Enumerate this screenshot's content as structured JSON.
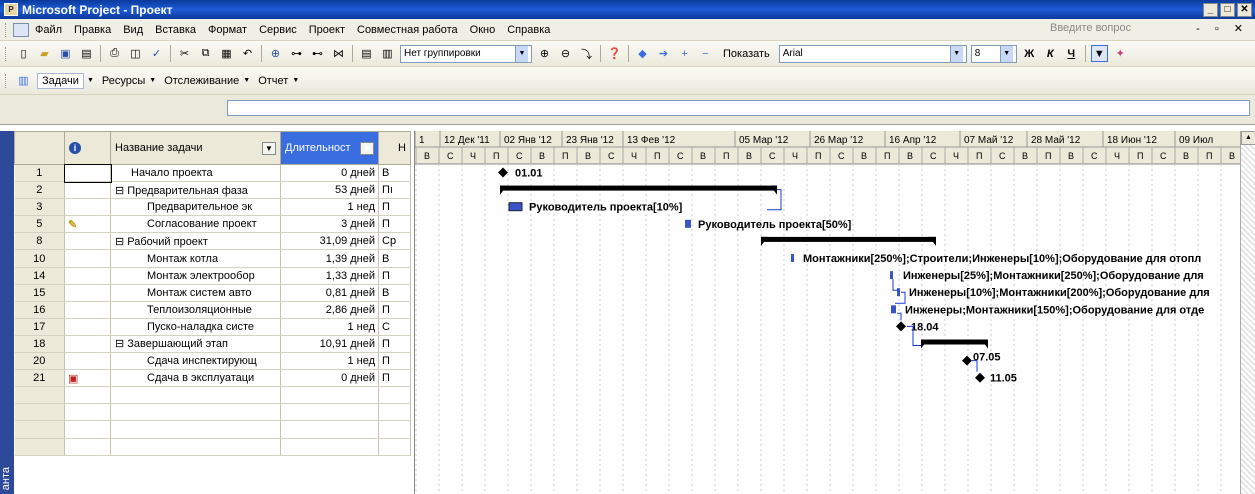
{
  "window": {
    "title": "Microsoft Project - Проект"
  },
  "menu": {
    "items": [
      "Файл",
      "Правка",
      "Вид",
      "Вставка",
      "Формат",
      "Сервис",
      "Проект",
      "Совместная работа",
      "Окно",
      "Справка"
    ],
    "ask_placeholder": "Введите вопрос"
  },
  "toolbar": {
    "grouping": "Нет группировки",
    "show": "Показать",
    "font": "Arial",
    "font_size": "8",
    "bold": "Ж",
    "italic": "К",
    "underline": "Ч"
  },
  "guide": {
    "tasks": "Задачи",
    "resources": "Ресурсы",
    "tracking": "Отслеживание",
    "report": "Отчет"
  },
  "view_label": "анта",
  "table": {
    "headers": {
      "info": "i",
      "name": "Название задачи",
      "duration": "Длительност",
      "start": "Н"
    },
    "rows": [
      {
        "id": "1",
        "name": "Начало проекта",
        "duration": "0 дней",
        "start": "В",
        "summary": false,
        "indent": 1
      },
      {
        "id": "2",
        "name": "⊟ Предварительная фаза",
        "duration": "53 дней",
        "start": "Пı",
        "summary": true,
        "indent": 0
      },
      {
        "id": "3",
        "name": "Предварительное эк",
        "duration": "1 нед",
        "start": "П",
        "summary": false,
        "indent": 2
      },
      {
        "id": "5",
        "name": "Согласование проект",
        "duration": "3 дней",
        "start": "П",
        "summary": false,
        "indent": 2
      },
      {
        "id": "8",
        "name": "⊟ Рабочий проект",
        "duration": "31,09 дней",
        "start": "Ср",
        "summary": true,
        "indent": 0
      },
      {
        "id": "10",
        "name": "Монтаж котла",
        "duration": "1,39 дней",
        "start": "В",
        "summary": false,
        "indent": 2
      },
      {
        "id": "14",
        "name": "Монтаж электрообор",
        "duration": "1,33 дней",
        "start": "П",
        "summary": false,
        "indent": 2
      },
      {
        "id": "15",
        "name": "Монтаж систем авто",
        "duration": "0,81 дней",
        "start": "В",
        "summary": false,
        "indent": 2
      },
      {
        "id": "16",
        "name": "Теплоизоляционные",
        "duration": "2,86 дней",
        "start": "П",
        "summary": false,
        "indent": 2
      },
      {
        "id": "17",
        "name": "Пуско-наладка систе",
        "duration": "1 нед",
        "start": "С",
        "summary": false,
        "indent": 2
      },
      {
        "id": "18",
        "name": "⊟ Завершающий этап",
        "duration": "10,91 дней",
        "start": "П",
        "summary": true,
        "indent": 0
      },
      {
        "id": "20",
        "name": "Сдача инспектирующ",
        "duration": "1 нед",
        "start": "П",
        "summary": false,
        "indent": 2
      },
      {
        "id": "21",
        "name": "Сдача в эксплуатаци",
        "duration": "0 дней",
        "start": "П",
        "summary": false,
        "indent": 2
      }
    ]
  },
  "gantt": {
    "weeks": [
      "1",
      "12 Дек '11",
      "02 Янв '12",
      "23 Янв '12",
      "13 Фев '12",
      "05 Мар '12",
      "26 Мар '12",
      "16 Апр '12",
      "07 Май '12",
      "28 Май '12",
      "18 Июн '12",
      "09 Июл"
    ],
    "days": [
      "В",
      "С",
      "Ч",
      "П",
      "С",
      "В",
      "П",
      "В",
      "С",
      "Ч",
      "П",
      "С",
      "В",
      "П",
      "В",
      "С",
      "Ч",
      "П",
      "С",
      "В",
      "П",
      "В",
      "С",
      "Ч",
      "П",
      "С",
      "В",
      "П",
      "В",
      "С",
      "Ч",
      "П",
      "С",
      "В",
      "П",
      "В"
    ],
    "labels": {
      "milestone_start": "01.01",
      "res_3": "Руководитель проекта[10%]",
      "res_5": "Руководитель проекта[50%]",
      "res_10": "Монтажники[250%];Строители;Инженеры[10%];Оборудование для отопл",
      "res_14": "Инженеры[25%];Монтажники[250%];Оборудование для",
      "res_15": "Инженеры[10%];Монтажники[200%];Оборудование для",
      "res_16": "Инженеры;Монтажники[150%];Оборудование для отде",
      "milestone_17": "18.04",
      "milestone_20": "07.05",
      "milestone_21": "11.05"
    }
  },
  "colors": {
    "summary_bar": "#000000",
    "task_bar": "#3a55c8",
    "link": "#1a3ad8",
    "title": "#0a3a9c"
  }
}
